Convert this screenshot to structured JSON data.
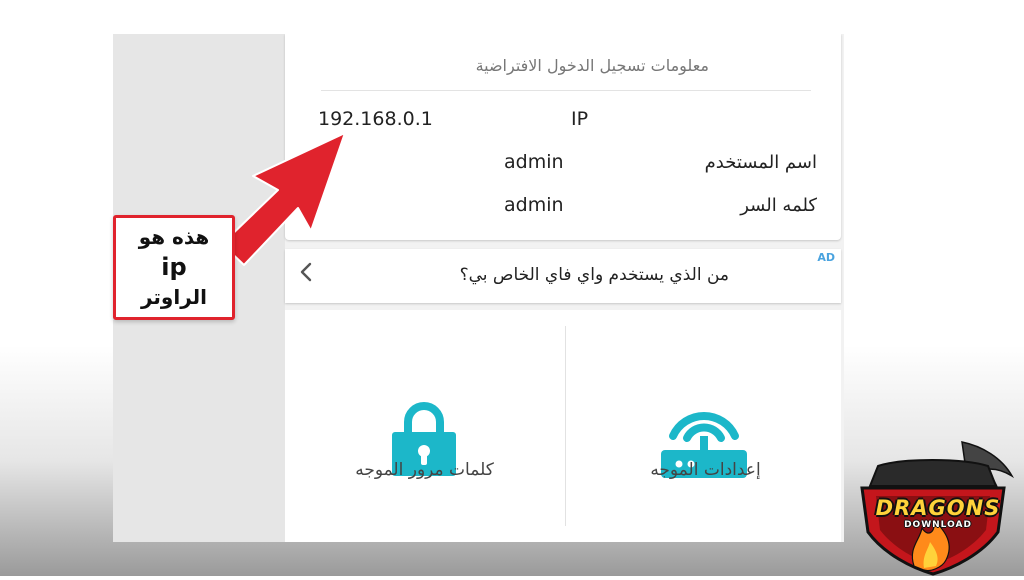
{
  "card": {
    "title": "معلومات تسجيل الدخول الافتراضية",
    "ip_value": "192.168.0.1",
    "ip_label": "IP",
    "username_value": "admin",
    "username_label": "اسم المستخدم",
    "password_value": "admin",
    "password_label": "كلمه السر"
  },
  "ad": {
    "badge": "AD",
    "text": "من الذي يستخدم واي فاي الخاص بي؟",
    "icon": "chevron-left-icon"
  },
  "tiles": [
    {
      "label": "كلمات مرور الموجه",
      "icon": "lock-icon"
    },
    {
      "label": "إعدادات الموجه",
      "icon": "router-wifi-icon"
    }
  ],
  "callout": {
    "line1": "هذه هو",
    "line2": "ip",
    "line3": "الراوتر"
  },
  "logo": {
    "name": "DRAGONS",
    "sub": "DOWNLOAD"
  },
  "colors": {
    "accent": "#1cb7c9",
    "arrow": "#e0232d",
    "ad_badge": "#4aa3df"
  }
}
